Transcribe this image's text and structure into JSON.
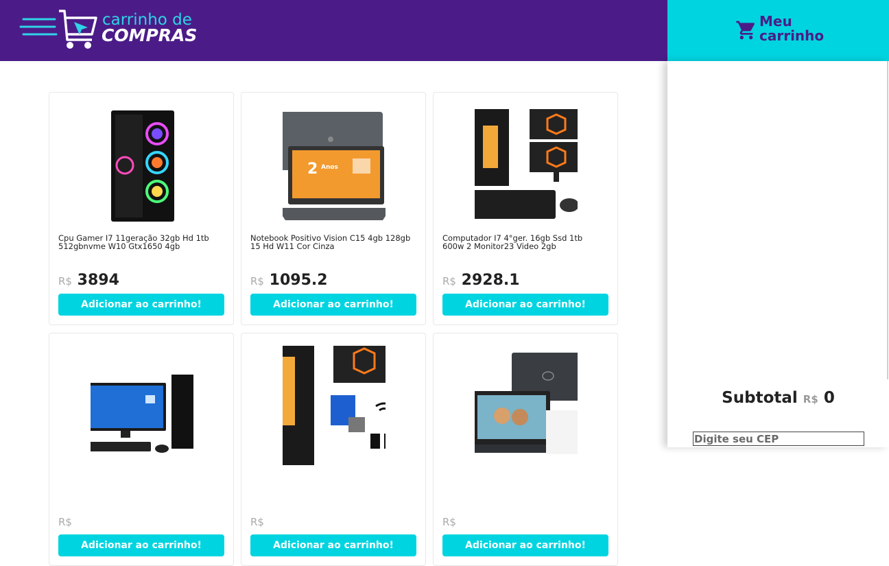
{
  "header": {
    "logo_line1": "carrinho de",
    "logo_line2": "COMPRAS"
  },
  "cart": {
    "title": "Meu carrinho",
    "subtotal_label": "Subtotal",
    "currency": "R$",
    "subtotal_value": "0",
    "cep_placeholder": "Digite seu CEP"
  },
  "products": [
    {
      "title": "Cpu Gamer I7 11geração 32gb Hd 1tb 512gbnvme W10 Gtx1650 4gb",
      "currency": "R$",
      "price": "3894",
      "button": "Adicionar ao carrinho!"
    },
    {
      "title": "Notebook Positivo Vision C15 4gb 128gb 15 Hd W11 Cor Cinza",
      "currency": "R$",
      "price": "1095.2",
      "button": "Adicionar ao carrinho!"
    },
    {
      "title": "Computador I7 4°ger. 16gb Ssd 1tb 600w 2 Monitor23 Video 2gb",
      "currency": "R$",
      "price": "2928.1",
      "button": "Adicionar ao carrinho!"
    },
    {
      "title": "",
      "currency": "R$",
      "price": "",
      "button": "Adicionar ao carrinho!"
    },
    {
      "title": "",
      "currency": "R$",
      "price": "",
      "button": "Adicionar ao carrinho!"
    },
    {
      "title": "",
      "currency": "R$",
      "price": "",
      "button": "Adicionar ao carrinho!"
    }
  ],
  "colors": {
    "header_bg": "#4b1c88",
    "accent": "#00d4e0"
  }
}
